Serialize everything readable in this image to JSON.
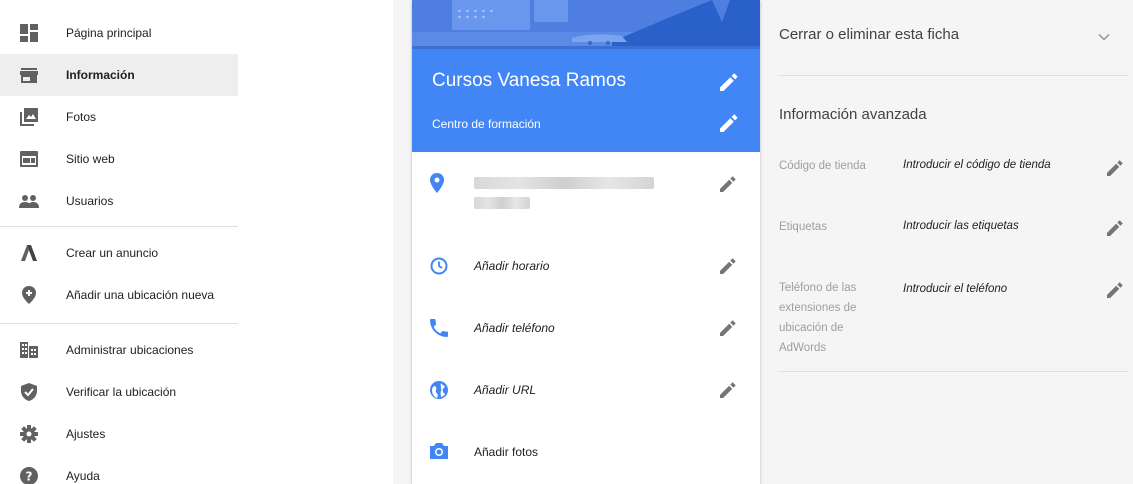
{
  "sidebar": {
    "items": [
      {
        "label": "Página principal",
        "icon": "dashboard-icon"
      },
      {
        "label": "Información",
        "icon": "store-icon",
        "active": true
      },
      {
        "label": "Fotos",
        "icon": "photos-icon"
      },
      {
        "label": "Sitio web",
        "icon": "website-icon"
      },
      {
        "label": "Usuarios",
        "icon": "users-icon"
      },
      {
        "label": "Crear un anuncio",
        "icon": "adwords-icon"
      },
      {
        "label": "Añadir una ubicación nueva",
        "icon": "add-location-icon"
      },
      {
        "label": "Administrar ubicaciones",
        "icon": "locations-grid-icon"
      },
      {
        "label": "Verificar la ubicación",
        "icon": "verified-shield-icon"
      },
      {
        "label": "Ajustes",
        "icon": "settings-icon"
      },
      {
        "label": "Ayuda",
        "icon": "help-icon"
      }
    ]
  },
  "card": {
    "business_name": "Cursos Vanesa Ramos",
    "category": "Centro de formación",
    "rows": [
      {
        "label": "Añadir horario",
        "icon": "clock-icon"
      },
      {
        "label": "Añadir teléfono",
        "icon": "phone-icon"
      },
      {
        "label": "Añadir URL",
        "icon": "globe-icon"
      },
      {
        "label": "Añadir fotos",
        "icon": "camera-icon"
      }
    ]
  },
  "right_panel": {
    "close_title": "Cerrar o eliminar esta ficha",
    "advanced_title": "Información avanzada",
    "fields": [
      {
        "label": "Código de tienda",
        "value": "Introducir el código de tienda"
      },
      {
        "label": "Etiquetas",
        "value": "Introducir las etiquetas"
      },
      {
        "label": "Teléfono de las extensiones de ubicación de AdWords",
        "value": "Introducir el teléfono"
      }
    ]
  },
  "colors": {
    "accent_blue": "#4285f4",
    "icon_grey": "#616161",
    "pencil_grey": "#757575"
  }
}
